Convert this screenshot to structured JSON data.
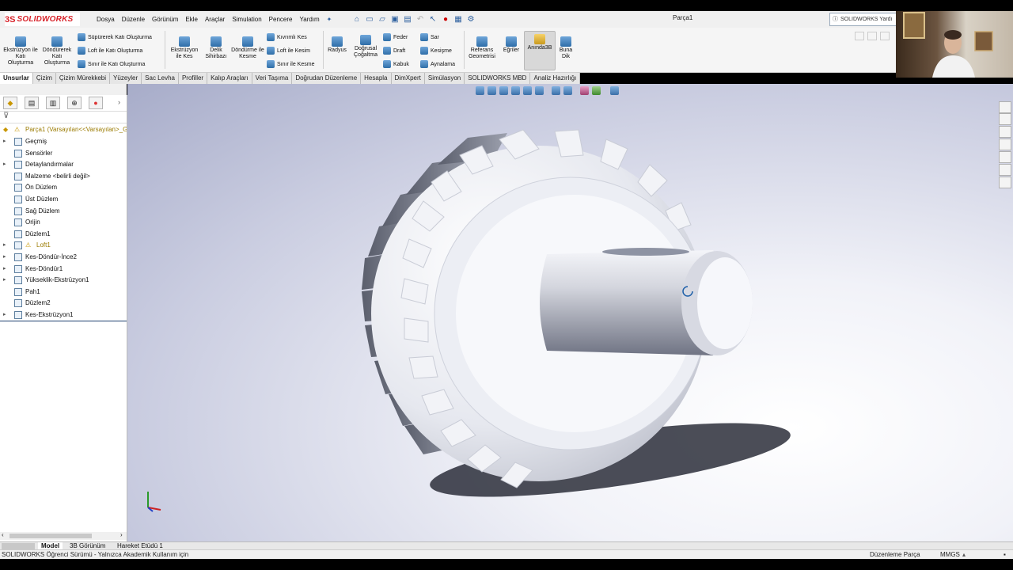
{
  "app": {
    "logo_ds": "3S",
    "logo_text": "SOLIDWORKS",
    "document_title": "Parça1",
    "help_search": "SOLIDWORKS Yardı"
  },
  "menu": [
    "Dosya",
    "Düzenle",
    "Görünüm",
    "Ekle",
    "Araçlar",
    "Simulation",
    "Pencere",
    "Yardım"
  ],
  "ribbon": {
    "extrude": "Ekstrüzyon ile Katı Oluşturma",
    "revolve": "Döndürerek Katı Oluşturma",
    "sweep": "Süpürerek Katı Oluşturma",
    "loft": "Loft ile Katı Oluşturma",
    "boundary": "Sınır ile Katı Oluşturma",
    "extrude_cut": "Ekstrüzyon ile Kes",
    "hole_wizard": "Delik Sihirbazı",
    "revolve_cut": "Döndürme ile Kesme",
    "swept_cut": "Kıvrımlı Kes",
    "loft_cut": "Loft ile Kesim",
    "boundary_cut": "Sınır ile Kesme",
    "fillet": "Radyus",
    "linear_pattern": "Doğrusal Çoğaltma",
    "rib": "Feder",
    "draft": "Draft",
    "shell": "Kabuk",
    "wrap": "Sar",
    "intersect": "Kesişme",
    "mirror": "Aynalama",
    "ref_geometry": "Referans Geometrisi",
    "curves": "Eğriler",
    "instant3d": "Anında3B",
    "bunadik": "Buna Dik"
  },
  "tabs": [
    "Unsurlar",
    "Çizim",
    "Çizim Mürekkebi",
    "Yüzeyler",
    "Sac Levha",
    "Profiller",
    "Kalıp Araçları",
    "Veri Taşıma",
    "Doğrudan Düzenleme",
    "Hesapla",
    "DimXpert",
    "Simülasyon",
    "SOLIDWORKS MBD",
    "Analiz Hazırlığı"
  ],
  "tree": {
    "root": "Parça1  (Varsayılan<<Varsayılan>_G",
    "items": [
      {
        "label": "Geçmiş",
        "expand": true
      },
      {
        "label": "Sensörler",
        "expand": false
      },
      {
        "label": "Detaylandırmalar",
        "expand": true
      },
      {
        "label": "Malzeme <belirli değil>",
        "expand": false
      },
      {
        "label": "Ön Düzlem",
        "expand": false
      },
      {
        "label": "Üst Düzlem",
        "expand": false
      },
      {
        "label": "Sağ Düzlem",
        "expand": false
      },
      {
        "label": "Orijin",
        "expand": false
      },
      {
        "label": "Düzlem1",
        "expand": false
      },
      {
        "label": "Loft1",
        "expand": true,
        "warning": true
      },
      {
        "label": "Kes-Döndür-İnce2",
        "expand": true
      },
      {
        "label": "Kes-Döndür1",
        "expand": true
      },
      {
        "label": "Yükseklik-Ekstrüzyon1",
        "expand": true
      },
      {
        "label": "Pah1",
        "expand": false
      },
      {
        "label": "Düzlem2",
        "expand": false
      },
      {
        "label": "Kes-Ekstrüzyon1",
        "expand": true
      }
    ]
  },
  "bottom_tabs": [
    "Model",
    "3B Görünüm",
    "Hareket Etüdü 1"
  ],
  "status": {
    "left": "SOLIDWORKS Öğrenci Sürümü - Yalnızca Akademik Kullanım için",
    "mode": "Düzenleme Parça",
    "units": "MMGS"
  },
  "colors": {
    "accent": "#d8232a",
    "ribbon_icon": "#2f6ea8"
  }
}
